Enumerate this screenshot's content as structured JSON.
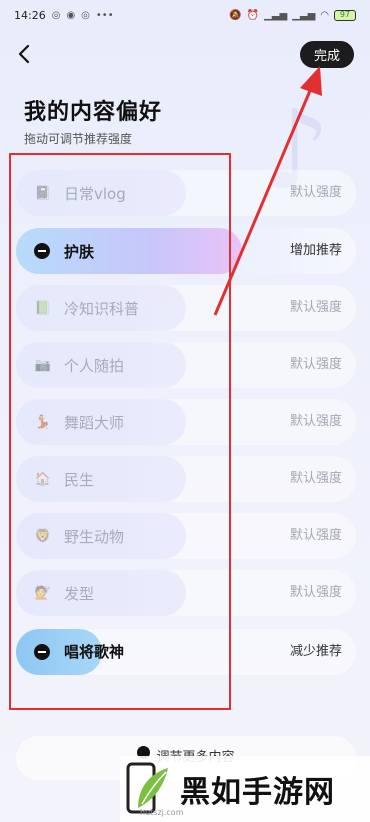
{
  "status_bar": {
    "time": "14:26",
    "battery": "97"
  },
  "header": {
    "done_label": "完成",
    "title": "我的内容偏好",
    "subtitle": "拖动可调节推荐强度"
  },
  "preferences": [
    {
      "label": "日常vlog",
      "strength": "默认强度",
      "icon": "notebook-icon",
      "state": "default"
    },
    {
      "label": "护肤",
      "strength": "增加推荐",
      "icon": "minus-circle-icon",
      "state": "increased"
    },
    {
      "label": "冷知识科普",
      "strength": "默认强度",
      "icon": "book-icon",
      "state": "default"
    },
    {
      "label": "个人随拍",
      "strength": "默认强度",
      "icon": "camera-person-icon",
      "state": "default"
    },
    {
      "label": "舞蹈大师",
      "strength": "默认强度",
      "icon": "dance-icon",
      "state": "default"
    },
    {
      "label": "民生",
      "strength": "默认强度",
      "icon": "house-icon",
      "state": "default"
    },
    {
      "label": "野生动物",
      "strength": "默认强度",
      "icon": "animal-icon",
      "state": "default"
    },
    {
      "label": "发型",
      "strength": "默认强度",
      "icon": "hair-icon",
      "state": "default"
    },
    {
      "label": "唱将歌神",
      "strength": "减少推荐",
      "icon": "minus-circle-icon",
      "state": "decreased"
    }
  ],
  "footer": {
    "more_label": "调节更多内容"
  },
  "watermark": {
    "text": "黑如手游网",
    "url": "hutszj.com"
  },
  "colors": {
    "annotation": "#e23030",
    "done_button": "#1c1c1e"
  }
}
